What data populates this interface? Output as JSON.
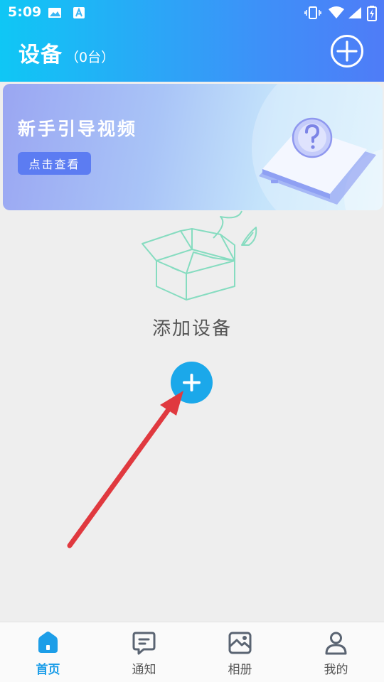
{
  "status_bar": {
    "time": "5:09"
  },
  "header": {
    "title": "设备",
    "count": "（0台）"
  },
  "banner": {
    "title": "新手引导视频",
    "button": "点击查看"
  },
  "empty": {
    "label": "添加设备"
  },
  "tabs": [
    {
      "label": "首页",
      "icon": "home-icon",
      "active": true
    },
    {
      "label": "通知",
      "icon": "message-icon",
      "active": false
    },
    {
      "label": "相册",
      "icon": "album-icon",
      "active": false
    },
    {
      "label": "我的",
      "icon": "user-icon",
      "active": false
    }
  ],
  "colors": {
    "header_start": "#0fc7f5",
    "header_end": "#4f7cf7",
    "accent": "#1ba8ea",
    "arrow": "#e0393f"
  }
}
